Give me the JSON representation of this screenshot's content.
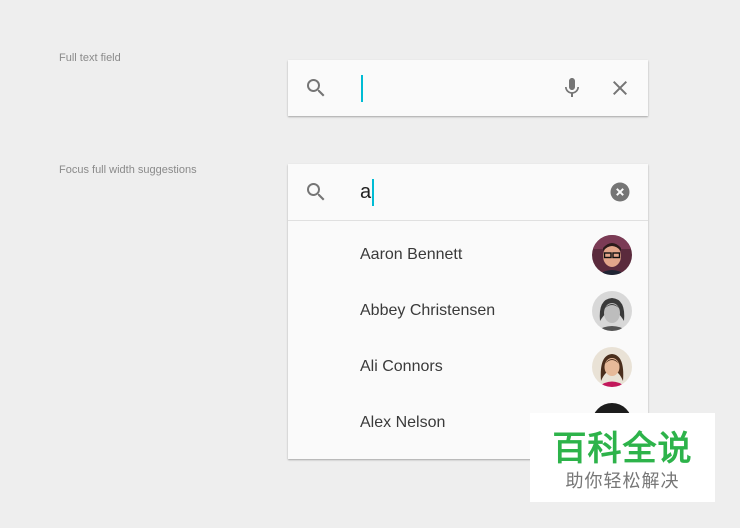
{
  "sections": {
    "full_text_field": {
      "label": "Full text field"
    },
    "focus_suggestions": {
      "label": "Focus full width suggestions"
    }
  },
  "search_field_1": {
    "value": "",
    "icons": {
      "left": "search-icon",
      "right": [
        "mic-icon",
        "close-icon"
      ]
    }
  },
  "search_field_2": {
    "value": "a",
    "icons": {
      "left": "search-icon",
      "right": [
        "clear-circle-icon"
      ]
    }
  },
  "suggestions": [
    {
      "name": "Aaron Bennett",
      "avatar": "avatar-photo"
    },
    {
      "name": "Abbey Christensen",
      "avatar": "avatar-photo"
    },
    {
      "name": "Ali Connors",
      "avatar": "avatar-photo"
    },
    {
      "name": "Alex Nelson",
      "avatar": "avatar-photo"
    }
  ],
  "watermark": {
    "title": "百科全说",
    "subtitle": "助你轻松解决"
  },
  "colors": {
    "background": "#eeeeee",
    "card": "#fafafa",
    "caret": "#00bcd4",
    "icon": "#757575",
    "watermark_green": "#2db34a"
  }
}
